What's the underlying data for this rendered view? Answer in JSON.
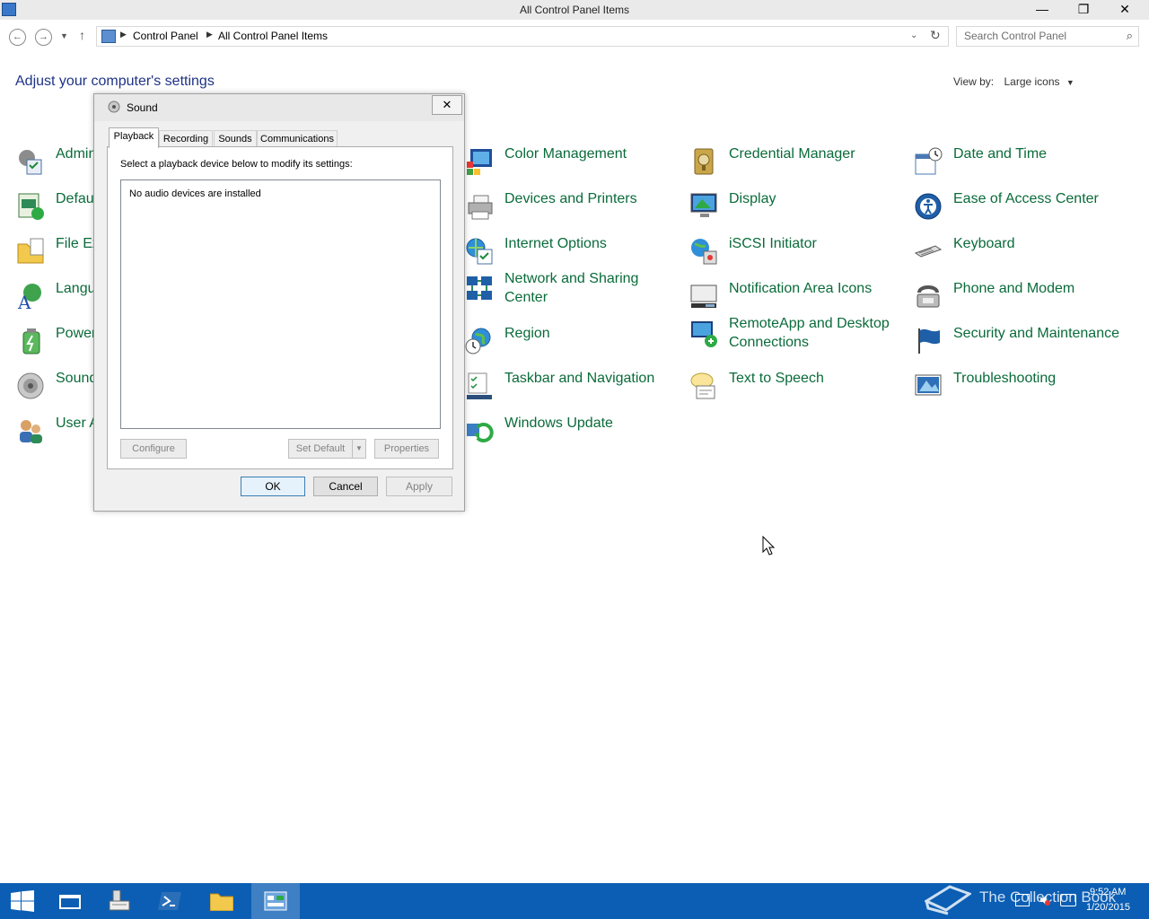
{
  "window": {
    "title": "All Control Panel Items",
    "minimize_glyph": "—",
    "maximize_glyph": "❐",
    "close_glyph": "✕"
  },
  "nav": {
    "breadcrumb": [
      "Control Panel",
      "All Control Panel Items"
    ],
    "search_placeholder": "Search Control Panel"
  },
  "page": {
    "heading": "Adjust your computer's settings",
    "view_by_label": "View by:",
    "view_by_value": "Large icons"
  },
  "items": [
    {
      "label": "Admin",
      "icon": "admin-tools-icon"
    },
    {
      "label": "Defau",
      "icon": "default-programs-icon"
    },
    {
      "label": "File Ex",
      "icon": "file-explorer-options-icon"
    },
    {
      "label": "Langu",
      "icon": "language-icon"
    },
    {
      "label": "Power",
      "icon": "power-options-icon"
    },
    {
      "label": "Sound",
      "icon": "sound-icon"
    },
    {
      "label": "User A",
      "icon": "user-accounts-icon"
    },
    {
      "label": "Color Management",
      "icon": "color-management-icon"
    },
    {
      "label": "Devices and Printers",
      "icon": "devices-printers-icon"
    },
    {
      "label": "Internet Options",
      "icon": "internet-options-icon"
    },
    {
      "label": "Network and Sharing Center",
      "icon": "network-sharing-icon"
    },
    {
      "label": "Region",
      "icon": "region-icon"
    },
    {
      "label": "Taskbar and Navigation",
      "icon": "taskbar-icon"
    },
    {
      "label": "Windows Update",
      "icon": "windows-update-icon"
    },
    {
      "label": "Credential Manager",
      "icon": "credential-manager-icon"
    },
    {
      "label": "Display",
      "icon": "display-icon"
    },
    {
      "label": "iSCSI Initiator",
      "icon": "iscsi-icon"
    },
    {
      "label": "Notification Area Icons",
      "icon": "notification-area-icon"
    },
    {
      "label": "RemoteApp and Desktop Connections",
      "icon": "remoteapp-icon"
    },
    {
      "label": "Text to Speech",
      "icon": "text-to-speech-icon"
    },
    {
      "label": "Date and Time",
      "icon": "date-time-icon"
    },
    {
      "label": "Ease of Access Center",
      "icon": "ease-of-access-icon"
    },
    {
      "label": "Keyboard",
      "icon": "keyboard-icon"
    },
    {
      "label": "Phone and Modem",
      "icon": "phone-modem-icon"
    },
    {
      "label": "Security and Maintenance",
      "icon": "security-maintenance-icon"
    },
    {
      "label": "Troubleshooting",
      "icon": "troubleshooting-icon"
    }
  ],
  "sound_dialog": {
    "title": "Sound",
    "close_glyph": "✕",
    "tabs": [
      "Playback",
      "Recording",
      "Sounds",
      "Communications"
    ],
    "instruction": "Select a playback device below to modify its settings:",
    "empty_message": "No audio devices are installed",
    "configure": "Configure",
    "set_default": "Set Default",
    "properties": "Properties",
    "ok": "OK",
    "cancel": "Cancel",
    "apply": "Apply"
  },
  "taskbar": {
    "watermark": "The Collection Book",
    "time": "9:52 AM",
    "date": "1/20/2015"
  },
  "colors": {
    "link_green": "#0a6b3a",
    "heading_blue": "#1e3287",
    "taskbar_blue": "#0b5eb3"
  }
}
